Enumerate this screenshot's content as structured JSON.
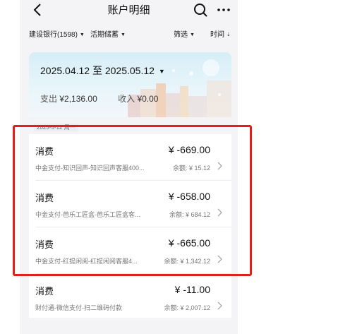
{
  "header": {
    "title": "账户明细"
  },
  "filters": {
    "account": "建设银行(1598)",
    "deposit_type": "活期储蓄",
    "filter_label": "筛选",
    "sort_label": "时间"
  },
  "summary": {
    "date_range": "2025.04.12 至 2025.05.12",
    "expense_label": "支出",
    "expense_value": "¥2,136.00",
    "income_label": "收入",
    "income_value": "¥0.00"
  },
  "list": {
    "date_tag": "2025-5-12 周一",
    "transactions": [
      {
        "type": "消费",
        "amount": "¥ -669.00",
        "description": "中金支付-知识回声-知识回声客服400...",
        "balance": "余额: ¥ 15.12"
      },
      {
        "type": "消费",
        "amount": "¥ -658.00",
        "description": "中金支付-芭乐工匠盒-芭乐工匠盒客...",
        "balance": "余额: ¥ 684.12"
      },
      {
        "type": "消费",
        "amount": "¥ -665.00",
        "description": "中金支付-红提闲阅-红提闲阅客服4...",
        "balance": "余额: ¥ 1,342.12"
      },
      {
        "type": "消费",
        "amount": "¥ -11.00",
        "description": "财付通-微信支付-扫二维码付款",
        "balance": "余额: ¥ 2,007.12"
      }
    ]
  },
  "colors": {
    "highlight": "#e0201b",
    "background": "#f4f4f6"
  }
}
